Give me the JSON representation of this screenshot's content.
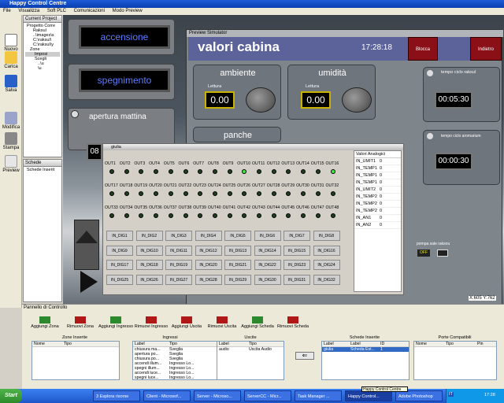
{
  "app_title": "Happy Control Centre",
  "menu": [
    "File",
    "Visualizza",
    "Soft PLC",
    "Comunicazioni",
    "Modo Preview"
  ],
  "toolbar": [
    {
      "label": "Nuovo",
      "icon": "new-file-icon"
    },
    {
      "label": "Carica",
      "icon": "folder-open-icon"
    },
    {
      "label": "Salva",
      "icon": "save-icon"
    },
    {
      "label": "Modifica",
      "icon": "edit-icon"
    },
    {
      "label": "Stampa",
      "icon": "print-icon"
    },
    {
      "label": "Preview",
      "icon": "preview-icon"
    }
  ],
  "project_panel": {
    "title": "Current Project",
    "tree": [
      "Progetto Corre",
      "Raksul",
      "..\\images\\s",
      "C:\\raksul\\",
      "C:\\raksul\\y",
      "Zone",
      "Imposi",
      "Scegli",
      "..\\u",
      "\\u"
    ]
  },
  "schede_panel": {
    "title": "Schede",
    "tree": [
      "Schede Inserit"
    ]
  },
  "canvas": {
    "accensione": "accensione",
    "spegnimento": "spegnimento",
    "apertura": "apertura mattina",
    "apertura_val": "08"
  },
  "preview": {
    "window_title": "Preview Simulator",
    "heading": "valori cabina",
    "clock": "17:28:18",
    "blocca": "Blocca",
    "indietro": "Indietro",
    "ambiente": "ambiente",
    "umidita": "umidità",
    "lettura": "Lettura",
    "ambiente_val": "0.00",
    "umidita_val": "0.00",
    "panche": "panche",
    "tempo_raksul_label": "tempo ciclo raksul",
    "tempo_raksul_val": "00:05:30",
    "tempo_aroma_label": "tempo ciclo aromarium",
    "tempo_aroma_val": "00:00:30",
    "pompa": "pompa sale raksou",
    "off": "OFF",
    "status": "X:605 Y:762"
  },
  "giulia": {
    "title": "giulia",
    "outputs": [
      [
        "OUT1",
        "OUT2",
        "OUT3",
        "OUT4",
        "OUT5",
        "OUT6",
        "OUT7",
        "OUT8",
        "OUT9",
        "OUT10",
        "OUT11",
        "OUT12",
        "OUT13",
        "OUT14",
        "OUT15",
        "OUT16"
      ],
      [
        "OUT17",
        "OUT18",
        "OUT19",
        "OUT20",
        "OUT21",
        "OUT22",
        "OUT23",
        "OUT24",
        "OUT25",
        "OUT26",
        "OUT27",
        "OUT28",
        "OUT29",
        "OUT30",
        "OUT31",
        "OUT32"
      ],
      [
        "OUT33",
        "OUT34",
        "OUT35",
        "OUT36",
        "OUT37",
        "OUT38",
        "OUT39",
        "OUT40",
        "OUT41",
        "OUT42",
        "OUT43",
        "OUT44",
        "OUT45",
        "OUT46",
        "OUT47",
        "OUT48"
      ]
    ],
    "outputs_on": [
      9,
      15
    ],
    "digital": [
      [
        "IN_DIG1",
        "IN_DIG2",
        "IN_DIG3",
        "IN_DIG4",
        "IN_DIG5",
        "IN_DIG6",
        "IN_DIG7",
        "IN_DIG8"
      ],
      [
        "IN_DIG9",
        "IN_DIG10",
        "IN_DIG11",
        "IN_DIG12",
        "IN_DIG13",
        "IN_DIG14",
        "IN_DIG15",
        "IN_DIG16"
      ],
      [
        "IN_DIG17",
        "IN_DIG18",
        "IN_DIG19",
        "IN_DIG20",
        "IN_DIG21",
        "IN_DIG22",
        "IN_DIG23",
        "IN_DIG24"
      ],
      [
        "IN_DIG25",
        "IN_DIG26",
        "IN_DIG27",
        "IN_DIG28",
        "IN_DIG29",
        "IN_DIG30",
        "IN_DIG31",
        "IN_DIG32"
      ]
    ],
    "analog_title": "Valori Analogici",
    "analog": [
      {
        "label": "IN_UMIT1",
        "value": "0"
      },
      {
        "label": "IN_TEMP1",
        "value": "0"
      },
      {
        "label": "IN_TEMP1",
        "value": "0"
      },
      {
        "label": "IN_TEMP1",
        "value": "0"
      },
      {
        "label": "IN_UMIT2",
        "value": "0"
      },
      {
        "label": "IN_TEMP2",
        "value": "0"
      },
      {
        "label": "IN_TEMP2",
        "value": "0"
      },
      {
        "label": "IN_TEMP2",
        "value": "0"
      },
      {
        "label": "IN_AN1",
        "value": "0"
      },
      {
        "label": "IN_AN2",
        "value": "0"
      }
    ]
  },
  "control": {
    "title": "Pannello di Controllo",
    "buttons": [
      "Aggiungi Zona",
      "Rimuovi Zona",
      "Aggiungi Ingresso",
      "Rimuovi Ingresso",
      "Aggiungi Uscita",
      "Rimuovi Uscita",
      "Aggiungi Scheda",
      "Rimuovi Scheda"
    ],
    "zone": {
      "title": "Zone Inserite",
      "cols": [
        "Nome",
        "Tipo"
      ]
    },
    "ingressi": {
      "title": "Ingressi",
      "cols": [
        "Label",
        "Tipo"
      ],
      "rows": [
        [
          "chiusura ma...",
          "Sveglia"
        ],
        [
          "apertura po...",
          "Sveglia"
        ],
        [
          "chiusura po...",
          "Sveglia"
        ],
        [
          "accendi illum...",
          "Ingresso Lo..."
        ],
        [
          "spegni illum...",
          "Ingresso Lo..."
        ],
        [
          "accendi luce...",
          "Ingresso Lo..."
        ],
        [
          "spegni luce...",
          "Ingresso Lo..."
        ]
      ]
    },
    "uscite": {
      "title": "Uscite",
      "cols": [
        "Label",
        "Tipo"
      ],
      "rows": [
        [
          "audio",
          "Uscita Audio"
        ]
      ]
    },
    "schede": {
      "title": "Schede Inserite",
      "cols": [
        "Label",
        "Label",
        "ID"
      ],
      "rows": [
        [
          "giulia",
          "Scheda Est...",
          "1"
        ]
      ]
    },
    "porte": {
      "title": "Porte Compatibili",
      "cols": [
        "Nome",
        "Tipo",
        "Pin"
      ]
    }
  },
  "taskbar": {
    "start": "Start",
    "tasks": [
      "3 Esplora risorse",
      "Client - Microsof...",
      "Server - Microso...",
      "ServerCC - Micr...",
      "Task Manager ...",
      "Happy Control...",
      "Adobe Photoshop"
    ],
    "tooltip": "Happy Control Centre",
    "lang": "IT",
    "time": "17:28"
  }
}
